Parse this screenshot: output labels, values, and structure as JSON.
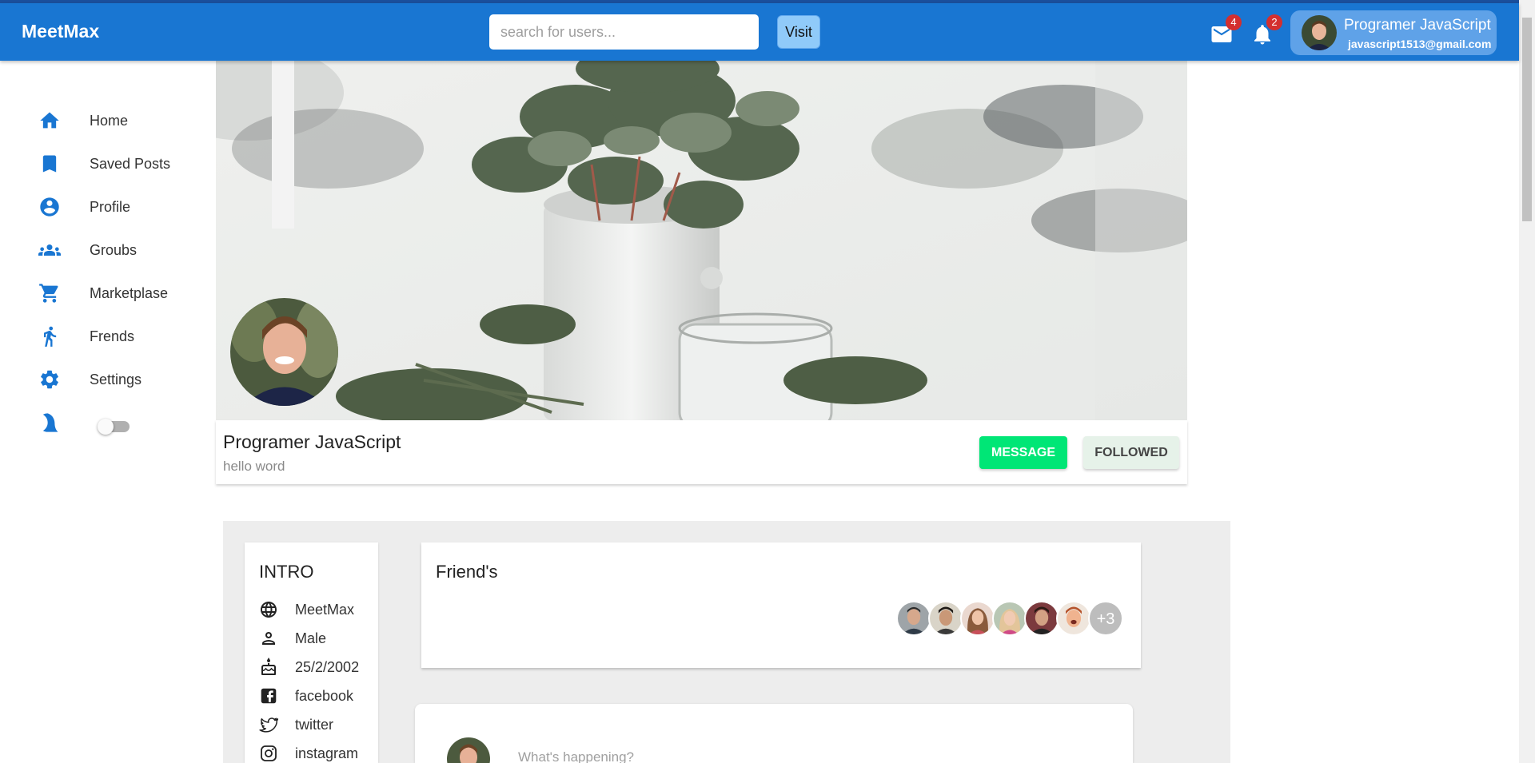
{
  "header": {
    "brand": "MeetMax",
    "search_placeholder": "search for users...",
    "visit_label": "Visit",
    "mail_icon": "mail-icon",
    "mail_badge": "4",
    "notif_icon": "bell-icon",
    "notif_badge": "2",
    "user_name": "Programer JavaScript",
    "user_email": "javascript1513@gmail.com"
  },
  "sidebar": {
    "items": [
      {
        "label": "Home",
        "icon": "home-icon"
      },
      {
        "label": "Saved Posts",
        "icon": "bookmark-icon"
      },
      {
        "label": "Profile",
        "icon": "account-circle-icon"
      },
      {
        "label": "Groubs",
        "icon": "groups-icon"
      },
      {
        "label": "Marketplase",
        "icon": "cart-icon"
      },
      {
        "label": "Frends",
        "icon": "person-walking-icon"
      },
      {
        "label": "Settings",
        "icon": "gear-icon"
      }
    ],
    "dark_mode_icon": "moon-icon",
    "dark_mode_on": false
  },
  "profile": {
    "name": "Programer JavaScript",
    "bio": "hello word",
    "message_label": "MESSAGE",
    "followed_label": "FOLLOWED"
  },
  "intro": {
    "title": "INTRO",
    "rows": [
      {
        "text": "MeetMax",
        "icon": "globe-icon"
      },
      {
        "text": "Male",
        "icon": "person-icon"
      },
      {
        "text": "25/2/2002",
        "icon": "cake-icon"
      },
      {
        "text": "facebook",
        "icon": "facebook-icon"
      },
      {
        "text": "twitter",
        "icon": "twitter-icon"
      },
      {
        "text": "instagram",
        "icon": "instagram-icon"
      }
    ]
  },
  "friends": {
    "title": "Friend's",
    "more_count": "+3"
  },
  "post": {
    "placeholder": "What's happening?"
  },
  "colors": {
    "appbar": "#1976d2",
    "accent_icon": "#1976d2",
    "message_button": "#00e676",
    "followed_button": "#e6f2e9",
    "badge": "#d32f2f",
    "content_bg": "#ededed"
  }
}
